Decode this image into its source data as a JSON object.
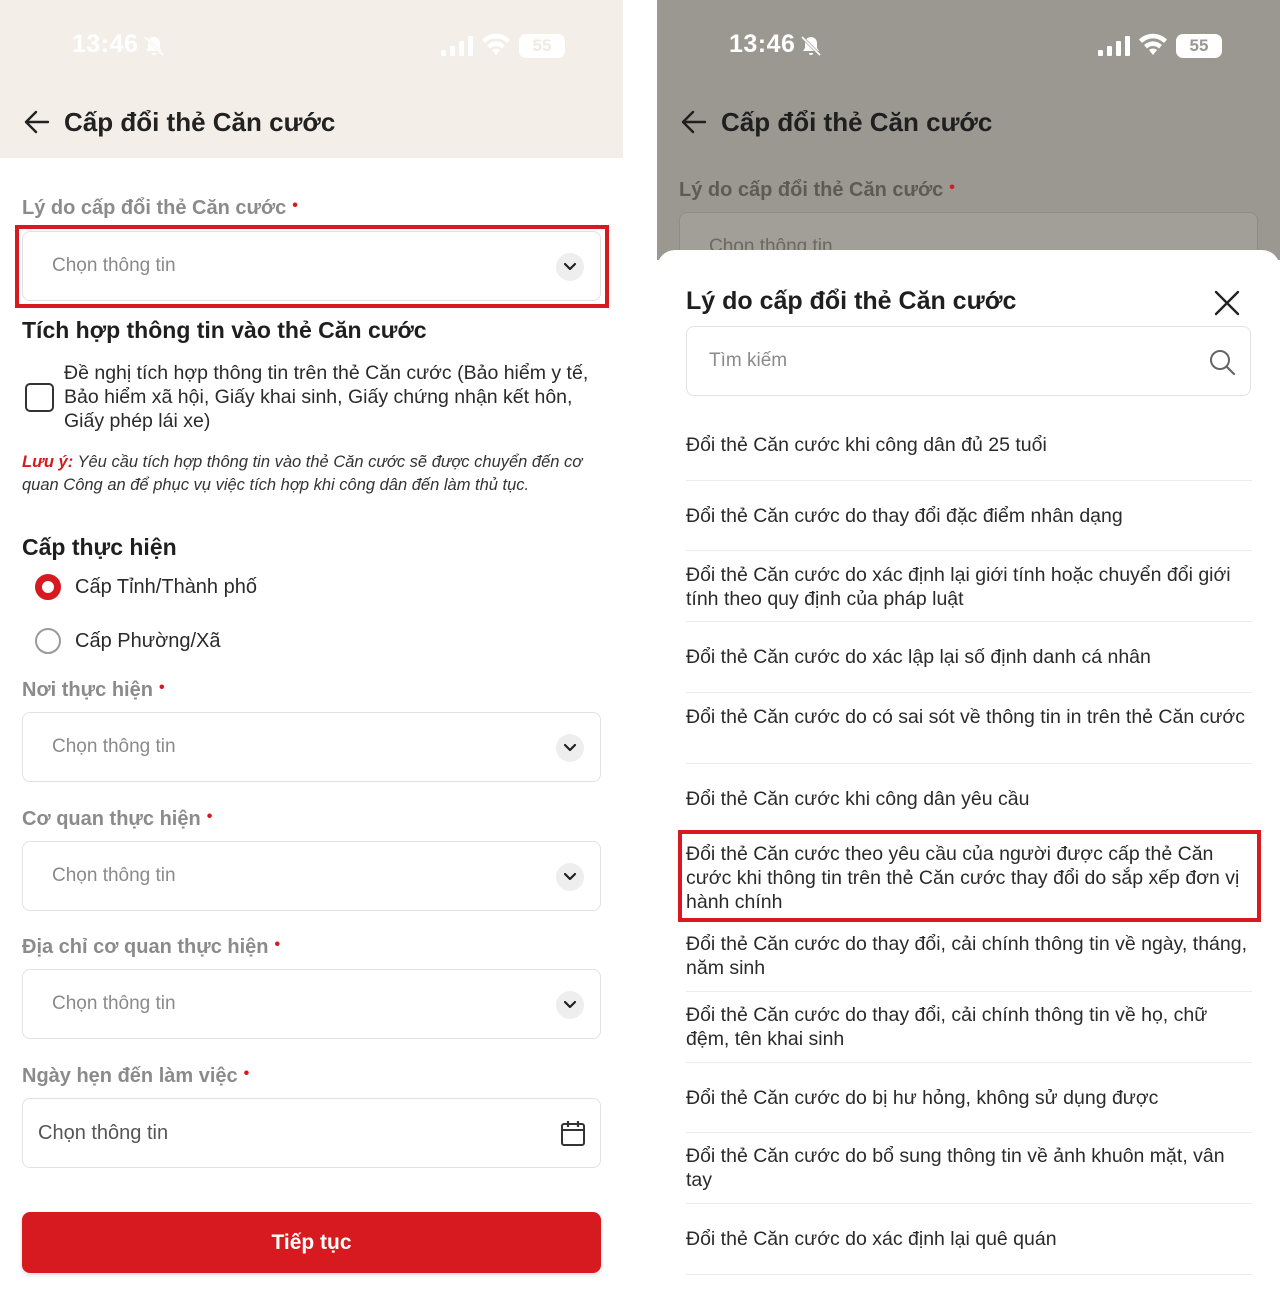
{
  "status": {
    "time": "13:46",
    "battery": "55"
  },
  "header": {
    "title": "Cấp đổi thẻ Căn cước"
  },
  "form": {
    "reason_label": "Lý do cấp đổi thẻ Căn cước",
    "required_mark": "•",
    "placeholder": "Chọn thông tin",
    "integration_title": "Tích hợp thông tin vào thẻ Căn cước",
    "integration_text": "Đề nghị tích hợp thông tin trên thẻ Căn cước (Bảo hiểm y tế, Bảo hiểm xã hội, Giấy khai sinh, Giấy chứng nhận kết hôn, Giấy phép lái xe)",
    "note_label": "Lưu ý:",
    "note_text": "Yêu cầu tích hợp thông tin vào thẻ Căn cước sẽ được chuyển đến cơ quan Công an để phục vụ việc tích hợp khi công dân đến làm thủ tục.",
    "level_title": "Cấp thực hiện",
    "levels": [
      {
        "label": "Cấp Tỉnh/Thành phố",
        "selected": true
      },
      {
        "label": "Cấp Phường/Xã",
        "selected": false
      }
    ],
    "place_label": "Nơi thực hiện",
    "agency_label": "Cơ quan thực hiện",
    "agency_address_label": "Địa chỉ cơ quan thực hiện",
    "appointment_label": "Ngày hẹn đến làm việc",
    "continue_label": "Tiếp tục",
    "accent_color": "#d71920"
  },
  "sheet": {
    "title": "Lý do cấp đổi thẻ Căn cước",
    "search_placeholder": "Tìm kiếm",
    "options": [
      "Đổi thẻ Căn cước khi công dân đủ 25 tuổi",
      "Đổi thẻ Căn cước do thay đổi đặc điểm nhân dạng",
      "Đổi thẻ Căn cước do xác định lại giới tính hoặc chuyển đổi giới tính theo quy định của pháp luật",
      "Đổi thẻ Căn cước do xác lập lại số định danh cá nhân",
      "Đổi thẻ Căn cước do có sai sót về thông tin in trên thẻ Căn cước",
      "Đổi thẻ Căn cước khi công dân yêu cầu",
      "Đổi thẻ Căn cước theo yêu cầu của người được cấp thẻ Căn cước khi thông tin trên thẻ Căn cước thay đổi do sắp xếp đơn vị hành chính",
      "Đổi thẻ Căn cước do thay đổi, cải chính thông tin về ngày, tháng, năm sinh",
      "Đổi thẻ Căn cước do thay đổi, cải chính thông tin về họ, chữ đệm, tên khai sinh",
      "Đổi thẻ Căn cước do bị hư hỏng, không sử dụng được",
      "Đổi thẻ Căn cước do bổ sung thông tin về ảnh khuôn mặt, vân tay",
      "Đổi thẻ Căn cước do xác định lại quê quán"
    ]
  }
}
